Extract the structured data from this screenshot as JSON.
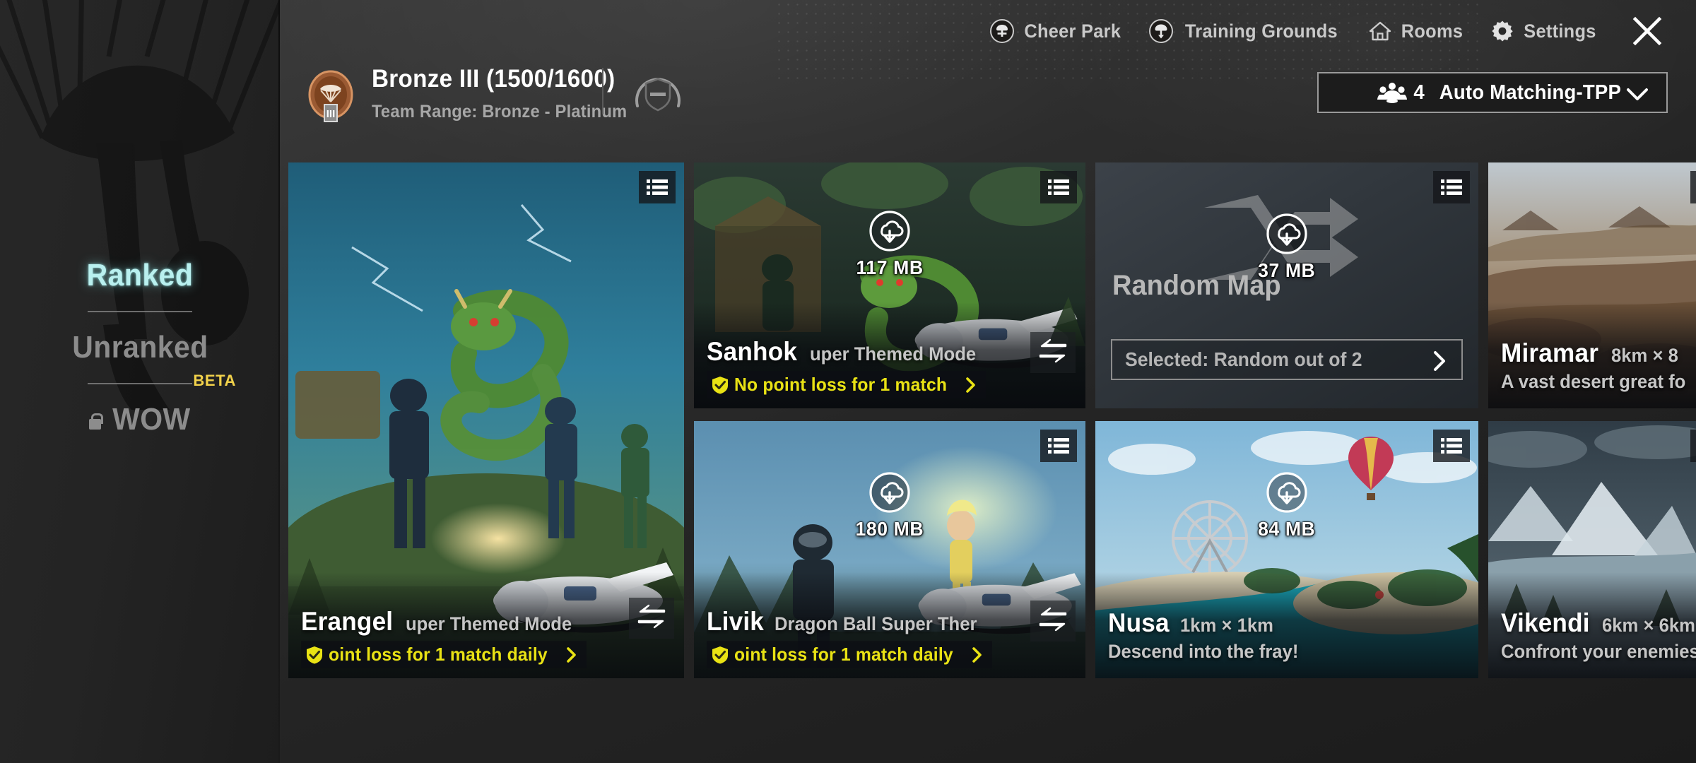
{
  "top_nav": {
    "items": [
      {
        "label": "Cheer Park",
        "icon": "cheer-park-icon"
      },
      {
        "label": "Training Grounds",
        "icon": "training-grounds-icon"
      },
      {
        "label": "Rooms",
        "icon": "home-icon"
      },
      {
        "label": "Settings",
        "icon": "gear-icon"
      }
    ],
    "close_icon": "close-icon"
  },
  "rank": {
    "title": "Bronze III (1500/1600)",
    "subtitle": "Team Range: Bronze - Platinum",
    "badge_tier": "III",
    "badge_icon": "bronze-rank-badge-icon",
    "protection_icon": "rank-protection-shield-icon"
  },
  "team_select": {
    "icon": "team-squad-icon",
    "count": "4",
    "label": "Auto Matching-TPP",
    "chevron_icon": "chevron-down-icon"
  },
  "sidebar": {
    "modes": [
      {
        "label": "Ranked",
        "active": true,
        "locked": false,
        "badge": ""
      },
      {
        "label": "Unranked",
        "active": false,
        "locked": false,
        "badge": ""
      },
      {
        "label": "WOW",
        "active": false,
        "locked": true,
        "badge": "BETA"
      }
    ]
  },
  "maps": [
    {
      "key": "erangel",
      "name": "Erangel",
      "meta": "uper Themed Mode",
      "promo": "oint loss for 1 match daily",
      "has_promo": true,
      "has_swap": true,
      "download": null,
      "menu_icon": "card-menu-icon",
      "swap_icon": "swap-arrows-icon",
      "promo_icon": "yellow-shield-check-icon",
      "promo_chevron_icon": "chevron-right-icon"
    },
    {
      "key": "sanhok",
      "name": "Sanhok",
      "meta": "uper Themed Mode",
      "promo": "No point loss for 1 match",
      "has_promo": true,
      "has_swap": true,
      "download": "117 MB",
      "menu_icon": "card-menu-icon",
      "swap_icon": "swap-arrows-icon",
      "promo_icon": "yellow-shield-check-icon",
      "promo_chevron_icon": "chevron-right-icon",
      "download_icon": "cloud-download-icon"
    },
    {
      "key": "livik",
      "name": "Livik",
      "meta": "Dragon Ball Super Ther",
      "promo": "oint loss for 1 match daily",
      "has_promo": true,
      "has_swap": true,
      "download": "180 MB",
      "menu_icon": "card-menu-icon",
      "swap_icon": "swap-arrows-icon",
      "promo_icon": "yellow-shield-check-icon",
      "promo_chevron_icon": "chevron-right-icon",
      "download_icon": "cloud-download-icon"
    },
    {
      "key": "random",
      "name": "Random Map",
      "selected_text": "Selected: Random out of 2",
      "download": "37 MB",
      "menu_icon": "card-menu-icon",
      "shuffle_icon": "shuffle-icon",
      "download_icon": "cloud-download-icon",
      "arrow_icon": "chevron-right-icon"
    },
    {
      "key": "nusa",
      "name": "Nusa",
      "meta": "1km × 1km",
      "desc": "Descend into the fray!",
      "has_promo": false,
      "has_swap": false,
      "download": "84 MB",
      "menu_icon": "card-menu-icon",
      "download_icon": "cloud-download-icon"
    },
    {
      "key": "miramar",
      "name": "Miramar",
      "meta": "8km × 8",
      "desc": "A vast desert great fo",
      "has_promo": false,
      "has_swap": false,
      "download": null
    },
    {
      "key": "vikendi",
      "name": "Vikendi",
      "meta": "6km × 6km",
      "desc": "Confront your enemies",
      "has_promo": false,
      "has_swap": false,
      "download": null
    }
  ],
  "colors": {
    "accent_cyan": "#b9f0ef",
    "promo_yellow": "#e9e214",
    "beta_yellow": "#f2d24b",
    "muted": "#8c8c8c",
    "panel": "#1c1c1c"
  }
}
